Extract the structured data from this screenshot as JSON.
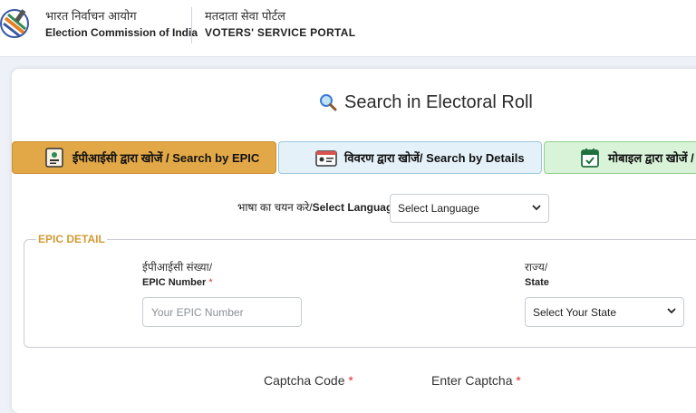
{
  "header": {
    "org_hindi": "भारत निर्वाचन आयोग",
    "org_english": "Election Commission of India",
    "portal_hindi": "मतदाता सेवा पोर्टल",
    "portal_english": "VOTERS' SERVICE PORTAL",
    "logo_icon": "eci-logo-icon"
  },
  "page": {
    "title": "Search in Electoral Roll",
    "title_icon": "search-icon"
  },
  "tabs": [
    {
      "label": "ईपीआईसी द्वारा खोजें / Search by EPIC",
      "icon": "id-card-icon",
      "color": "#e2a847",
      "active": true
    },
    {
      "label": "विवरण द्वारा खोजें/ Search by Details",
      "icon": "details-card-icon",
      "color": "#e4f1f8",
      "active": false
    },
    {
      "label": "मोबाइल द्वारा खोजें / S",
      "icon": "mobile-calendar-icon",
      "color": "#d8f3d8",
      "active": false
    }
  ],
  "language": {
    "label_hindi": "भाषा का चयन करे/",
    "label_english": "Select Language",
    "selected": "Select Language"
  },
  "epic_detail": {
    "legend": "EPIC DETAIL",
    "epic_label_hindi": "ईपीआईसी संख्या/",
    "epic_label_english": "EPIC Number",
    "epic_placeholder": "Your EPIC Number",
    "state_label_hindi": "राज्य/",
    "state_label_english": "State",
    "state_selected": "Select Your State",
    "required_mark": "*"
  },
  "captcha": {
    "code_label": "Captcha Code",
    "enter_label": "Enter Captcha",
    "required_mark": "*"
  },
  "colors": {
    "accent_orange": "#e2a847",
    "legend_orange": "#d39a36",
    "required_red": "#e03030"
  }
}
